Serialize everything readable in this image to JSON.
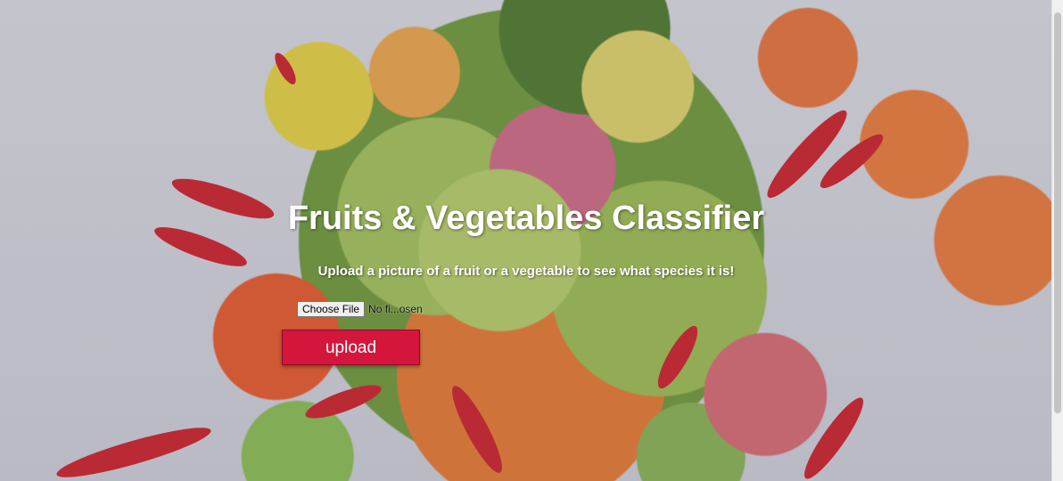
{
  "page": {
    "title": "Fruits & Vegetables Classifier",
    "subtitle": "Upload a picture of a fruit or a vegetable to see what species it is!"
  },
  "form": {
    "choose_file_label": "Choose File",
    "file_status": "No fi...osen",
    "upload_label": "upload"
  },
  "colors": {
    "upload_button": "#d4163c",
    "title_text": "#ffffff"
  },
  "background": {
    "description_icon": "fruits-vegetables-photo"
  }
}
